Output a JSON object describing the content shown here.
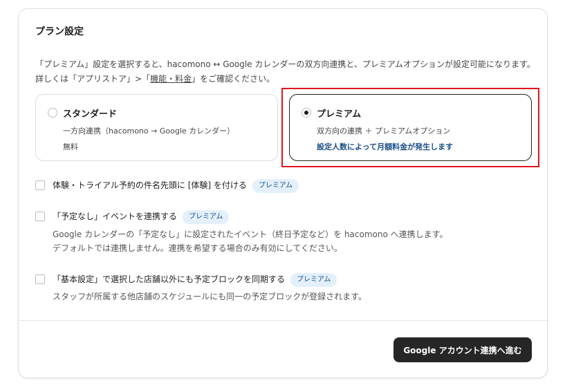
{
  "section": {
    "title": "プラン設定",
    "desc_line1": "「プレミアム」設定を選択すると、hacomono ↔ Google カレンダーの双方向連携と、プレミアムオプションが設定可能になります。",
    "desc_line2_prefix": "詳しくは「アプリストア」>「",
    "desc_line2_link": "機能・料金",
    "desc_line2_suffix": "」をご確認ください。"
  },
  "plans": {
    "standard": {
      "name": "スタンダード",
      "line1": "一方向連携（hacomono → Google カレンダー）",
      "line2": "無料",
      "selected": false
    },
    "premium": {
      "name": "プレミアム",
      "line1": "双方向の連携 ＋ プレミアムオプション",
      "line2": "設定人数によって月額料金が発生します",
      "selected": true
    }
  },
  "options": [
    {
      "label": "体験・トライアル予約の件名先頭に [体験] を付ける",
      "badge": "プレミアム",
      "checked": false,
      "sub": []
    },
    {
      "label": "「予定なし」イベントを連携する",
      "badge": "プレミアム",
      "checked": false,
      "sub": [
        "Google カレンダーの「予定なし」に設定されたイベント（終日予定など）を hacomono へ連携します。",
        "デフォルトでは連携しません。連携を希望する場合のみ有効にしてください。"
      ]
    },
    {
      "label": "「基本設定」で選択した店舗以外にも予定ブロックを同期する",
      "badge": "プレミアム",
      "checked": false,
      "sub": [
        "スタッフが所属する他店舗のスケジュールにも同一の予定ブロックが登録されます。"
      ]
    }
  ],
  "footer": {
    "cta_label": "Google アカウント連携へ進む"
  },
  "colors": {
    "highlight_border": "#e0141a",
    "badge_bg": "#e3f0fb",
    "badge_text": "#1a4f8b",
    "button_bg": "#262626"
  }
}
